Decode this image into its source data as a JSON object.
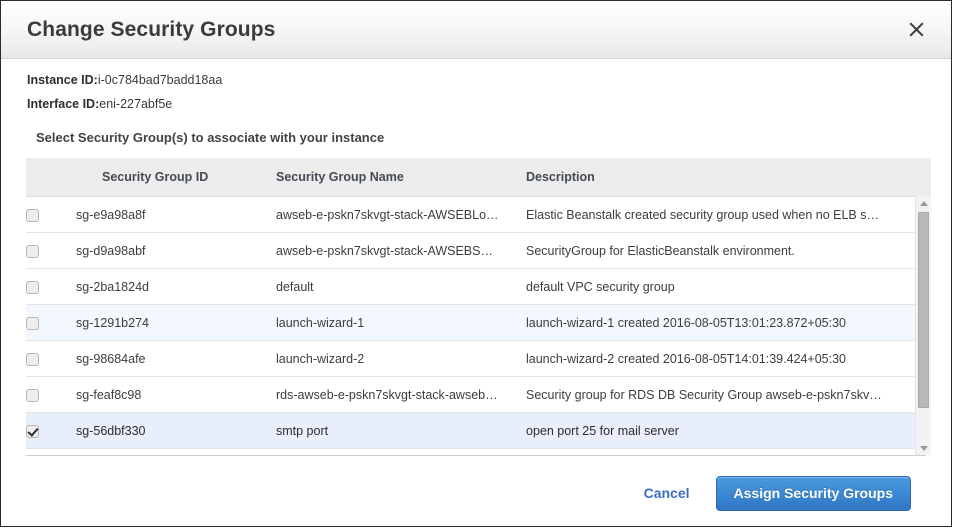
{
  "dialog": {
    "title": "Change Security Groups",
    "close_icon": "close-icon"
  },
  "info": {
    "instance_label": "Instance ID:",
    "instance_value": "i-0c784bad7badd18aa",
    "interface_label": "Interface ID:",
    "interface_value": "eni-227abf5e",
    "section_label": "Select Security Group(s) to associate with your instance"
  },
  "table": {
    "columns": [
      "",
      "Security Group ID",
      "Security Group Name",
      "Description"
    ],
    "rows": [
      {
        "checked": false,
        "id": "sg-e9a98a8f",
        "name": "awseb-e-pskn7skvgt-stack-AWSEBLo…",
        "description": "Elastic Beanstalk created security group used when no ELB s…",
        "state": "normal"
      },
      {
        "checked": false,
        "id": "sg-d9a98abf",
        "name": "awseb-e-pskn7skvgt-stack-AWSEBS…",
        "description": "SecurityGroup for ElasticBeanstalk environment.",
        "state": "normal"
      },
      {
        "checked": false,
        "id": "sg-2ba1824d",
        "name": "default",
        "description": "default VPC security group",
        "state": "normal"
      },
      {
        "checked": false,
        "id": "sg-1291b274",
        "name": "launch-wizard-1",
        "description": "launch-wizard-1 created 2016-08-05T13:01:23.872+05:30",
        "state": "hover"
      },
      {
        "checked": false,
        "id": "sg-98684afe",
        "name": "launch-wizard-2",
        "description": "launch-wizard-2 created 2016-08-05T14:01:39.424+05:30",
        "state": "normal"
      },
      {
        "checked": false,
        "id": "sg-feaf8c98",
        "name": "rds-awseb-e-pskn7skvgt-stack-awseb…",
        "description": "Security group for RDS DB Security Group awseb-e-pskn7skv…",
        "state": "normal"
      },
      {
        "checked": true,
        "id": "sg-56dbf330",
        "name": "smtp port",
        "description": "open port 25 for mail server",
        "state": "selected"
      }
    ]
  },
  "scrollbar": {
    "up_icon": "chevron-up-icon",
    "down_icon": "chevron-down-icon"
  },
  "footer": {
    "cancel_label": "Cancel",
    "assign_label": "Assign Security Groups"
  },
  "colors": {
    "primary_button": "#3d8ad4",
    "link": "#3b6ebd",
    "selected_row": "#e8eefa",
    "hover_row": "#f2f8fd",
    "header_bg": "#ececec"
  }
}
